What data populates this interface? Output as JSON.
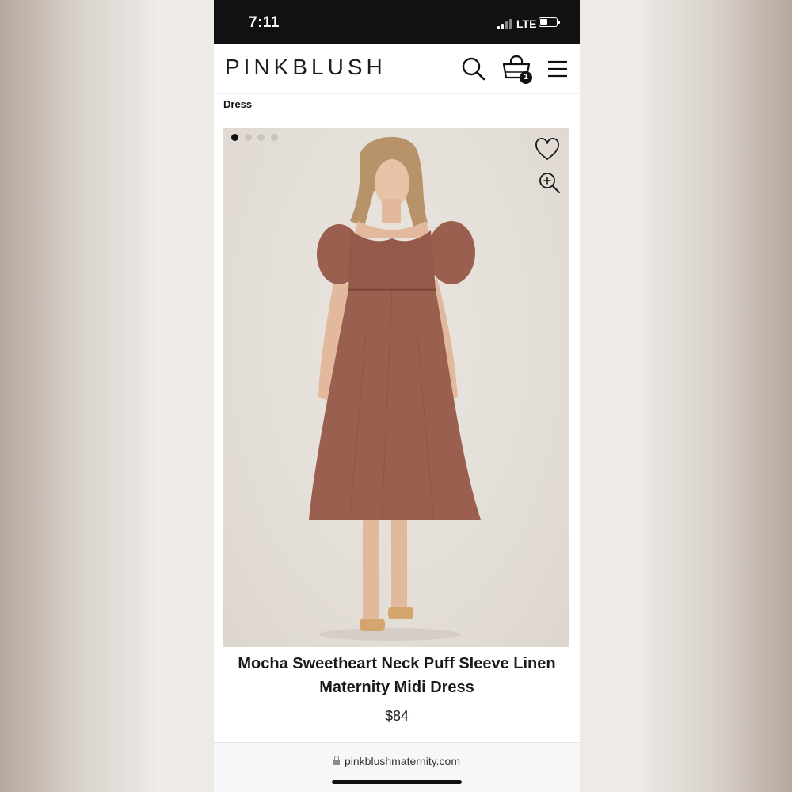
{
  "status_bar": {
    "time": "7:11",
    "network": "LTE"
  },
  "header": {
    "logo": "PINKBLUSH",
    "cart_count": "1",
    "icons": [
      "search-icon",
      "shopping-bag-icon",
      "menu-icon"
    ]
  },
  "breadcrumb": "Dress",
  "gallery": {
    "image_count": 4,
    "active_index": 0,
    "icons": [
      "heart-icon",
      "zoom-in-icon"
    ],
    "colors": {
      "dress": "#9a5f4f",
      "background": "#e6e0da"
    }
  },
  "product": {
    "title": "Mocha Sweetheart Neck Puff Sleeve Linen Maternity Midi Dress",
    "price": "$84"
  },
  "browser": {
    "url": "pinkblushmaternity.com"
  }
}
